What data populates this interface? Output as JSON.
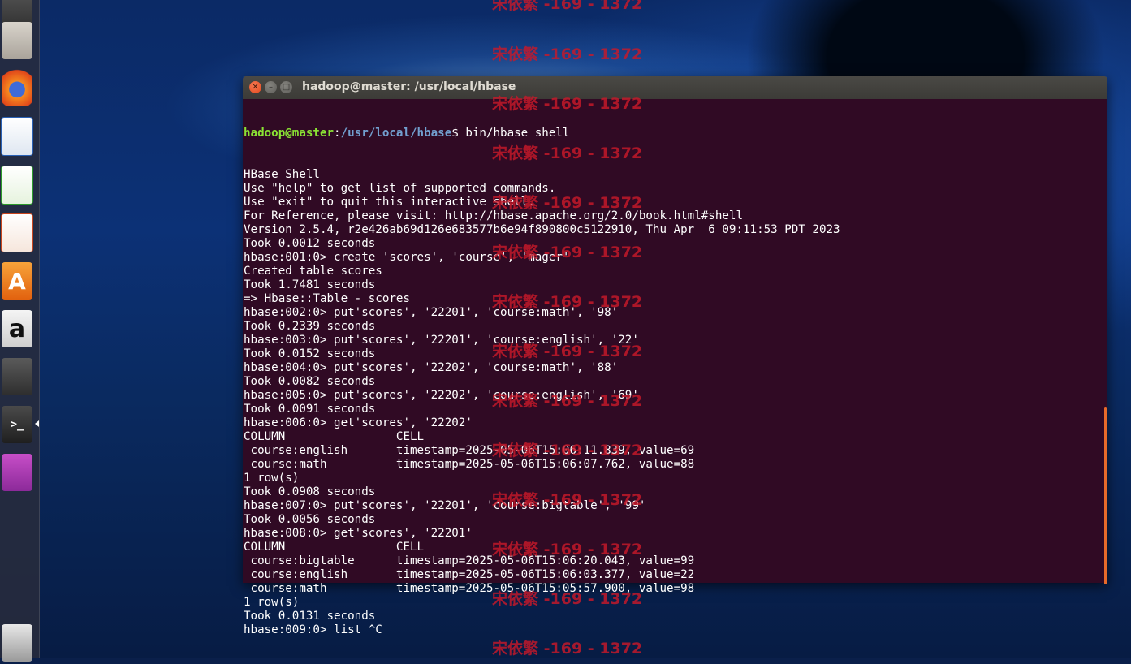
{
  "window": {
    "title": "hadoop@master: /usr/local/hbase"
  },
  "launcher": {
    "items": [
      {
        "name": "system-settings-icon"
      },
      {
        "name": "files-icon"
      },
      {
        "name": "firefox-icon"
      },
      {
        "name": "libreoffice-writer-icon"
      },
      {
        "name": "libreoffice-calc-icon"
      },
      {
        "name": "libreoffice-impress-icon"
      },
      {
        "name": "software-center-icon",
        "glyph": "A"
      },
      {
        "name": "amazon-icon",
        "glyph": "a"
      },
      {
        "name": "system-tools-icon"
      },
      {
        "name": "terminal-icon",
        "glyph": ">_"
      },
      {
        "name": "remote-desktop-icon"
      }
    ],
    "trash": {
      "name": "trash-icon"
    }
  },
  "terminal": {
    "prompt_user": "hadoop@master",
    "prompt_path": "/usr/local/hbase",
    "prompt_suffix": "$ bin/hbase shell",
    "lines": [
      "HBase Shell",
      "Use \"help\" to get list of supported commands.",
      "Use \"exit\" to quit this interactive shell.",
      "For Reference, please visit: http://hbase.apache.org/2.0/book.html#shell",
      "Version 2.5.4, r2e426ab69d126e683577b6e94f890800c5122910, Thu Apr  6 09:11:53 PDT 2023",
      "Took 0.0012 seconds",
      "hbase:001:0> create 'scores', 'course', 'mager'",
      "Created table scores",
      "Took 1.7481 seconds",
      "=> Hbase::Table - scores",
      "hbase:002:0> put'scores', '22201', 'course:math', '98'",
      "Took 0.2339 seconds",
      "hbase:003:0> put'scores', '22201', 'course:english', '22'",
      "Took 0.0152 seconds",
      "hbase:004:0> put'scores', '22202', 'course:math', '88'",
      "Took 0.0082 seconds",
      "hbase:005:0> put'scores', '22202', 'course:english', '69'",
      "Took 0.0091 seconds",
      "hbase:006:0> get'scores', '22202'",
      "COLUMN                CELL",
      " course:english       timestamp=2025-05-06T15:06:11.839, value=69",
      " course:math          timestamp=2025-05-06T15:06:07.762, value=88",
      "1 row(s)",
      "Took 0.0908 seconds",
      "hbase:007:0> put'scores', '22201', 'course:bigtable', '99'",
      "Took 0.0056 seconds",
      "hbase:008:0> get'scores', '22201'",
      "COLUMN                CELL",
      " course:bigtable      timestamp=2025-05-06T15:06:20.043, value=99",
      " course:english       timestamp=2025-05-06T15:06:03.377, value=22",
      " course:math          timestamp=2025-05-06T15:05:57.900, value=98",
      "1 row(s)",
      "Took 0.0131 seconds",
      "hbase:009:0> list ^C"
    ]
  },
  "watermark": {
    "text": "宋依繁 -169 - 1372",
    "color": "#c8192a"
  },
  "colors": {
    "terminal_bg": "#300a24",
    "prompt_user": "#8ae234",
    "prompt_path": "#729fcf",
    "scrollbar": "#e86a2a"
  }
}
